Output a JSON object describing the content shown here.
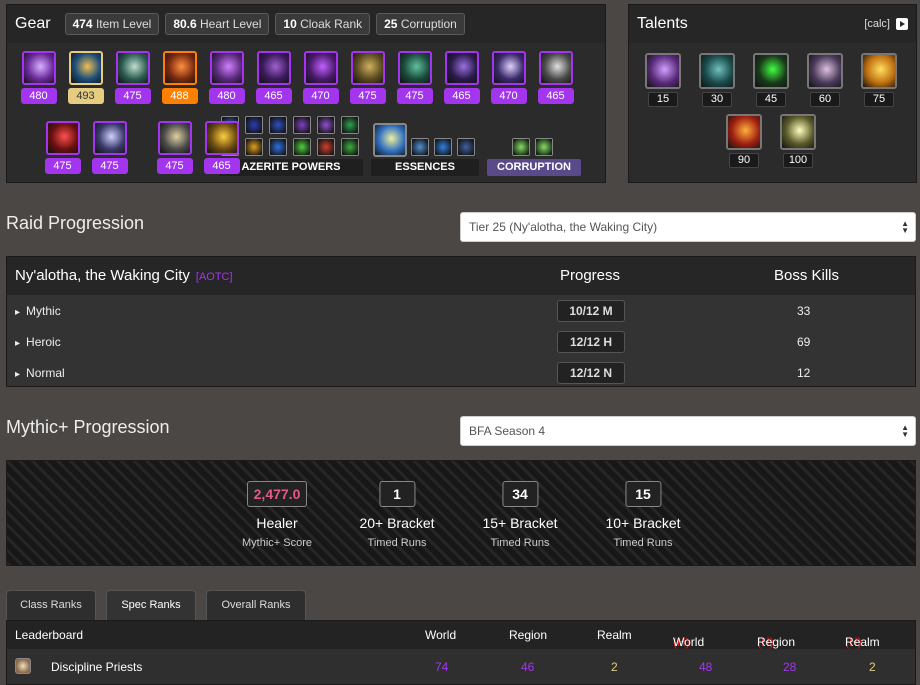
{
  "gear": {
    "title": "Gear",
    "stats": [
      {
        "value": "474",
        "label": "Item Level"
      },
      {
        "value": "80.6",
        "label": "Heart Level"
      },
      {
        "value": "10",
        "label": "Cloak Rank"
      },
      {
        "value": "25",
        "label": "Corruption"
      }
    ],
    "row1": [
      {
        "icon": "helm-icon",
        "ilvl": "480",
        "quality": "epic",
        "c1": "#6a2a9a",
        "c2": "#d9b0ff"
      },
      {
        "icon": "heart-of-azeroth-icon",
        "ilvl": "493",
        "quality": "artifact",
        "c1": "#1d4d7a",
        "c2": "#f0c050"
      },
      {
        "icon": "shoulder-icon",
        "ilvl": "475",
        "quality": "epic",
        "c1": "#2b5a50",
        "c2": "#c0e0d0"
      },
      {
        "icon": "cloak-icon",
        "ilvl": "488",
        "quality": "legendary",
        "c1": "#7a2a10",
        "c2": "#ff9040"
      },
      {
        "icon": "robe-icon",
        "ilvl": "480",
        "quality": "epic",
        "c1": "#5a2a7a",
        "c2": "#d080ff"
      },
      {
        "icon": "wrist-icon",
        "ilvl": "465",
        "quality": "epic",
        "c1": "#3a1a5a",
        "c2": "#a060d0"
      },
      {
        "icon": "gloves-icon",
        "ilvl": "470",
        "quality": "epic",
        "c1": "#4a1a6a",
        "c2": "#c060ff"
      },
      {
        "icon": "belt-icon",
        "ilvl": "475",
        "quality": "epic",
        "c1": "#5a4a20",
        "c2": "#d0b060"
      },
      {
        "icon": "legs-icon",
        "ilvl": "475",
        "quality": "epic",
        "c1": "#1a4a3a",
        "c2": "#60c0a0"
      },
      {
        "icon": "boots-icon",
        "ilvl": "465",
        "quality": "epic",
        "c1": "#2a1a4a",
        "c2": "#9a70e0"
      },
      {
        "icon": "ring-icon",
        "ilvl": "470",
        "quality": "epic",
        "c1": "#3a2a6a",
        "c2": "#e0d0ff"
      },
      {
        "icon": "ring-icon",
        "ilvl": "465",
        "quality": "epic",
        "c1": "#4a4a4a",
        "c2": "#e0e0e0"
      }
    ],
    "row2": [
      {
        "icon": "trinket-icon",
        "ilvl": "475",
        "quality": "epic",
        "c1": "#6a1010",
        "c2": "#ff5050"
      },
      {
        "icon": "trinket-icon",
        "ilvl": "475",
        "quality": "epic",
        "c1": "#3a3a6a",
        "c2": "#d0d0ff"
      },
      {
        "icon": "mace-icon",
        "ilvl": "475",
        "quality": "epic",
        "c1": "#4a4a4a",
        "c2": "#e0d0a0"
      },
      {
        "icon": "offhand-icon",
        "ilvl": "465",
        "quality": "epic",
        "c1": "#6a4a10",
        "c2": "#ffd040"
      }
    ],
    "azerite_label": "AZERITE POWERS",
    "azerite_icons": [
      {
        "icon": "azerite-power-icon",
        "c": "#3a5ad0"
      },
      {
        "icon": "azerite-power-icon",
        "c": "#2a40b0"
      },
      {
        "icon": "azerite-power-icon",
        "c": "#3050c0"
      },
      {
        "icon": "azerite-power-icon",
        "c": "#8040c0"
      },
      {
        "icon": "azerite-power-icon",
        "c": "#9050d0"
      },
      {
        "icon": "azerite-power-icon",
        "c": "#30a050"
      },
      {
        "icon": "azerite-power-icon",
        "c": "#20a060"
      },
      {
        "icon": "azerite-power-icon",
        "c": "#e0a020"
      },
      {
        "icon": "azerite-power-icon",
        "c": "#3070e0"
      },
      {
        "icon": "azerite-power-icon",
        "c": "#50d040"
      },
      {
        "icon": "azerite-power-icon",
        "c": "#d04030"
      },
      {
        "icon": "azerite-power-icon",
        "c": "#40b040"
      }
    ],
    "essences_label": "ESSENCES",
    "essence_major": {
      "icon": "essence-major-icon",
      "c1": "#3070c0",
      "c2": "#f0f0a0"
    },
    "essence_minors": [
      {
        "icon": "essence-minor-icon",
        "c": "#5090d0"
      },
      {
        "icon": "essence-minor-icon",
        "c": "#3080e0"
      },
      {
        "icon": "essence-minor-icon",
        "c": "#4060a0"
      }
    ],
    "corruption_label": "CORRUPTION",
    "corruption_icons": [
      {
        "icon": "corruption-icon",
        "c": "#4a8a3a"
      },
      {
        "icon": "corruption-icon",
        "c": "#4a8a3a"
      }
    ]
  },
  "talents": {
    "title": "Talents",
    "calc_label": "[calc]",
    "items": [
      {
        "icon": "talent-icon",
        "level": "15",
        "c1": "#5a2a7a",
        "c2": "#d0a0ff"
      },
      {
        "icon": "talent-icon",
        "level": "30",
        "c1": "#1a4a4a",
        "c2": "#70c0c0"
      },
      {
        "icon": "talent-icon",
        "level": "45",
        "c1": "#1a3a1a",
        "c2": "#40ff40"
      },
      {
        "icon": "talent-icon",
        "level": "60",
        "c1": "#4a3a5a",
        "c2": "#e0c0e0"
      },
      {
        "icon": "talent-icon",
        "level": "75",
        "c1": "#c07010",
        "c2": "#ffe060"
      },
      {
        "icon": "talent-icon",
        "level": "90",
        "c1": "#a02010",
        "c2": "#ffb040"
      },
      {
        "icon": "talent-icon",
        "level": "100",
        "c1": "#5a5a2a",
        "c2": "#ffffc0"
      }
    ]
  },
  "raid": {
    "heading": "Raid Progression",
    "tier_select": "Tier 25 (Ny'alotha, the Waking City)",
    "raid_name": "Ny'alotha, the Waking City",
    "raid_tag": "[AOTC]",
    "col_progress": "Progress",
    "col_kills": "Boss Kills",
    "rows": [
      {
        "difficulty": "Mythic",
        "progress": "10/12 M",
        "kills": "33"
      },
      {
        "difficulty": "Heroic",
        "progress": "12/12 H",
        "kills": "69"
      },
      {
        "difficulty": "Normal",
        "progress": "12/12 N",
        "kills": "12"
      }
    ]
  },
  "mplus": {
    "heading": "Mythic+ Progression",
    "season_select": "BFA Season 4",
    "stats": [
      {
        "value": "2,477.0",
        "title": "Healer",
        "sub": "Mythic+ Score"
      },
      {
        "value": "1",
        "title": "20+ Bracket",
        "sub": "Timed Runs"
      },
      {
        "value": "34",
        "title": "15+ Bracket",
        "sub": "Timed Runs"
      },
      {
        "value": "15",
        "title": "10+ Bracket",
        "sub": "Timed Runs"
      }
    ]
  },
  "ranks": {
    "tabs": [
      "Class Ranks",
      "Spec Ranks",
      "Overall Ranks"
    ],
    "active_tab": "Spec Ranks",
    "headers": {
      "leaderboard": "Leaderboard",
      "world": "World",
      "region": "Region",
      "realm": "Realm",
      "h_prefix": "(H)",
      "h_world": "World",
      "h_region": "Region",
      "h_realm": "Realm"
    },
    "rows": [
      {
        "icon": "discipline-priest-icon",
        "name": "Discipline Priests",
        "world": "74",
        "region": "46",
        "realm": "2",
        "h_world": "48",
        "h_region": "28",
        "h_realm": "2"
      }
    ]
  },
  "colors": {
    "epic": "#a335ee",
    "legendary": "#ff8000",
    "artifact": "#e6cc80",
    "horde": "#e02020"
  }
}
